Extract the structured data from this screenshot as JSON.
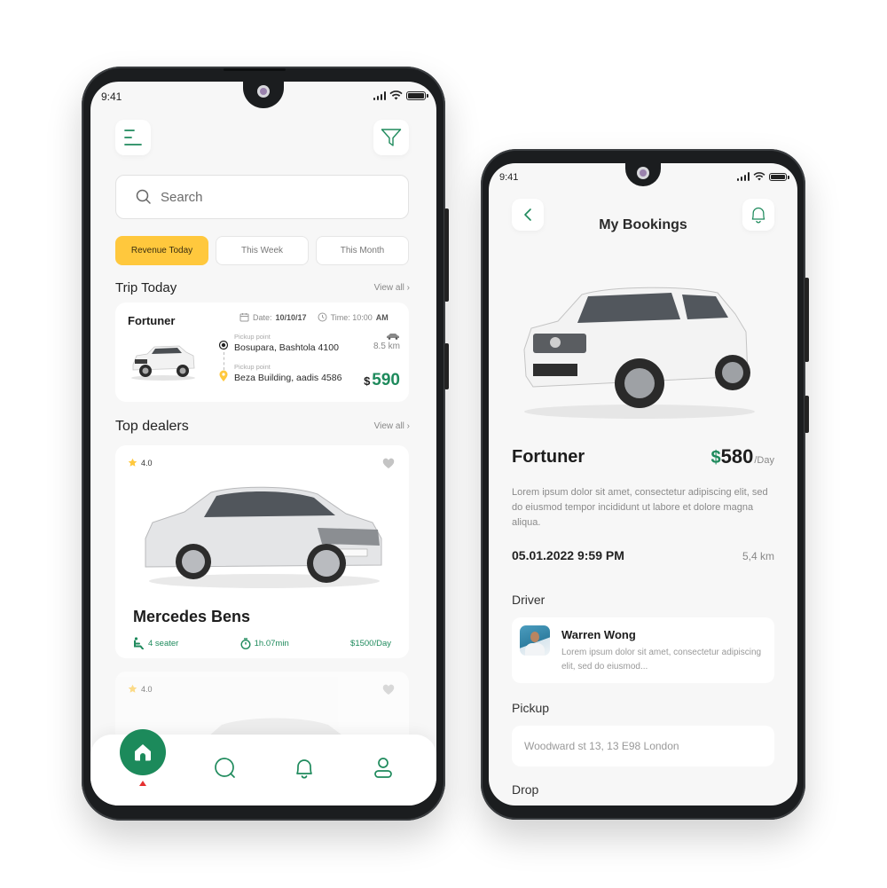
{
  "colors": {
    "accent_green": "#1e8a5c",
    "accent_yellow": "#ffc83d",
    "nav_indicator": "#e53030"
  },
  "left_phone": {
    "status_bar": {
      "time": "9:41"
    },
    "header": {
      "menu_icon": "menu-icon",
      "filter_icon": "filter-icon"
    },
    "search": {
      "placeholder": "Search",
      "value": ""
    },
    "tabs": [
      {
        "label": "Revenue Today",
        "active": true
      },
      {
        "label": "This Week",
        "active": false
      },
      {
        "label": "This Month",
        "active": false
      }
    ],
    "trip_today": {
      "title": "Trip Today",
      "view_all": "View all ›",
      "card": {
        "car_name": "Fortuner",
        "date_label": "Date:",
        "date_value": "10/10/17",
        "time_label": "Time: 10:00",
        "time_suffix": "AM",
        "pickup": {
          "label": "Pickup point",
          "address": "Bosupara, Bashtola 4100"
        },
        "dropoff": {
          "label": "Pickup point",
          "address": "Beza Building, aadis 4586"
        },
        "distance": "8.5 km",
        "currency": "$",
        "price": "590"
      }
    },
    "top_dealers": {
      "title": "Top dealers",
      "view_all": "View all ›",
      "cards": [
        {
          "rating": "4.0",
          "name": "Mercedes Bens",
          "seats": "4 seater",
          "duration": "1h.07min",
          "price": "$1500/Day"
        },
        {
          "rating": "4.0"
        }
      ]
    },
    "bottom_nav": {
      "items": [
        "home",
        "search",
        "notifications",
        "profile"
      ],
      "active": "home"
    }
  },
  "right_phone": {
    "status_bar": {
      "time": "9:41"
    },
    "header": {
      "title": "My Bookings"
    },
    "car": {
      "name": "Fortuner",
      "currency": "$",
      "price": "580",
      "per": "/Day",
      "description": "Lorem ipsum dolor sit amet, consectetur adipiscing elit, sed do eiusmod tempor incididunt ut labore et dolore magna aliqua.",
      "datetime": "05.01.2022 9:59 PM",
      "distance": "5,4 km"
    },
    "driver": {
      "section_label": "Driver",
      "name": "Warren Wong",
      "description": "Lorem ipsum dolor sit amet, consectetur adipiscing elit, sed do eiusmod..."
    },
    "pickup": {
      "section_label": "Pickup",
      "value": "Woodward st 13, 13 E98 London"
    },
    "drop": {
      "section_label": "Drop"
    }
  }
}
